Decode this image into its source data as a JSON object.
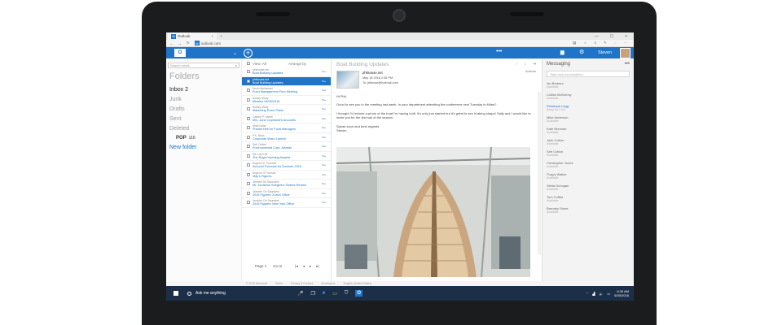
{
  "browser": {
    "tab_title": "Outlook",
    "tab_close": "×",
    "tab_add": "+",
    "url": "outlook.com",
    "win_min": "—",
    "win_max": "☐",
    "win_close": "×"
  },
  "appbar": {
    "logo": "O",
    "caret": "⌄",
    "new": "+",
    "dots": "•••",
    "user": "Steven"
  },
  "folders": {
    "search_placeholder": "Search email",
    "title": "Folders",
    "items": [
      {
        "label": "Inbox 2",
        "active": true
      },
      {
        "label": "Junk"
      },
      {
        "label": "Drafts"
      },
      {
        "label": "Sent"
      },
      {
        "label": "Deleted"
      }
    ],
    "sub": {
      "label": "POP",
      "count": "116"
    },
    "new_folder": "New folder"
  },
  "list": {
    "view": "View: All",
    "arrange": "Arrange by",
    "rows": [
      {
        "from": "phlisouse.net",
        "subject": "Boat Building Updates",
        "date": "Tue",
        "selected": false
      },
      {
        "from": "phlisouse.net",
        "subject": "Boat Building Updates",
        "date": "Tue",
        "selected": true
      },
      {
        "from": "Kevin Mohamed",
        "subject": "Fund Management Firm Meeting",
        "date": "Tue"
      },
      {
        "from": "Ashley Matry",
        "subject": "Minutes 06/05/2016",
        "date": "Tue"
      },
      {
        "from": "Ashley Matry",
        "subject": "Marketing Event Plans",
        "date": "Tue"
      },
      {
        "from": "Gabriel P. Kiehel",
        "subject": "Mrs. Jane Copeland's Accounts",
        "date": "Tue"
      },
      {
        "from": "Mark Holst",
        "subject": "Private Hire for Fund Managers",
        "date": "Tue"
      },
      {
        "from": "P.K. Nilan",
        "subject": "Corporate Video Launch",
        "date": "Tue"
      },
      {
        "from": "Seb Coffee",
        "subject": "Environmental Corp. Awards",
        "date": "Tue"
      },
      {
        "from": "Ms. Lily Ede",
        "subject": "The Royal Yachting Awards",
        "date": "Tue"
      },
      {
        "from": "Eugene D. Forester",
        "subject": "Account Forecast for Summer 2016",
        "date": "Tue"
      },
      {
        "from": "Eugene O Forester",
        "subject": "May's Figures",
        "date": "Tue"
      },
      {
        "from": "Jennifer Dil Saunders",
        "subject": "Mr. Jonathon Sobgels's Shares Review",
        "date": "Tue"
      },
      {
        "from": "Jennifer On Saunders",
        "subject": "2016 Figures: Zurich Office",
        "date": "Tue"
      },
      {
        "from": "Jennifer On Saunders",
        "subject": "2016 Figures: New York Office",
        "date": "Tue"
      }
    ],
    "pager_page": "Page 1",
    "pager_goto": "Go to",
    "nav": [
      "|◂",
      "◂",
      "▸",
      "▸|"
    ]
  },
  "reading": {
    "title": "Boat Building Updates",
    "tools": [
      "↑",
      "↓",
      "⇥"
    ],
    "sender_name": "phlisouse.net",
    "sender_date": "May 18 2016 2:36 PM",
    "sender_to": "To: jeftouse@hotmail.com",
    "actions": "Actions",
    "greeting": "Hi Phil,",
    "para1": "Good to see you in the meeting last week. In your department attending the conference next Tuesday in Milan?",
    "para2": "I thought I'd include a photo of the boat I'm having built. It's only just started but it's great to see it taking shape! Sally and I would like to invite you for the first sail of the season.",
    "signoff": "Speak soon and best regards,",
    "signature": "Steven"
  },
  "messaging": {
    "title": "Messaging",
    "dots": "•••",
    "search_placeholder": "Start new conversation",
    "contacts": [
      {
        "name": "Ian Barbers",
        "status": "Available"
      },
      {
        "name": "Collins McKinney",
        "status": "Available"
      },
      {
        "name": "Penelope Legg",
        "status": "Away for 2 hrs",
        "active": true
      },
      {
        "name": "Mike Anderson",
        "status": "Available"
      },
      {
        "name": "Kate Brennan",
        "status": "Available"
      },
      {
        "name": "Jack Cotton",
        "status": "Available"
      },
      {
        "name": "Seb Cotton",
        "status": "Available"
      },
      {
        "name": "Christopher Jones",
        "status": "Available"
      },
      {
        "name": "Poppy Walker",
        "status": "Available"
      },
      {
        "name": "Stella Ochogan",
        "status": "Available"
      },
      {
        "name": "Tom Coffee",
        "status": "Available"
      },
      {
        "name": "Barnaby Stone",
        "status": "Available"
      }
    ]
  },
  "statusbar": {
    "copyright": "© 2016 Microsoft",
    "terms": "Terms",
    "privacy": "Privacy & Cookies",
    "developers": "Developers",
    "english": "English (United States)"
  },
  "taskbar": {
    "search": "Ask me anything",
    "mic": "🎤",
    "taskview": "❐",
    "edge": "e",
    "explorer": "▭",
    "store": "⛉",
    "outlook": "O",
    "time": "6:30 AM",
    "date": "6/30/2016"
  },
  "colors": {
    "accent": "#1f74c8",
    "taskbar": "#1c2f48"
  }
}
